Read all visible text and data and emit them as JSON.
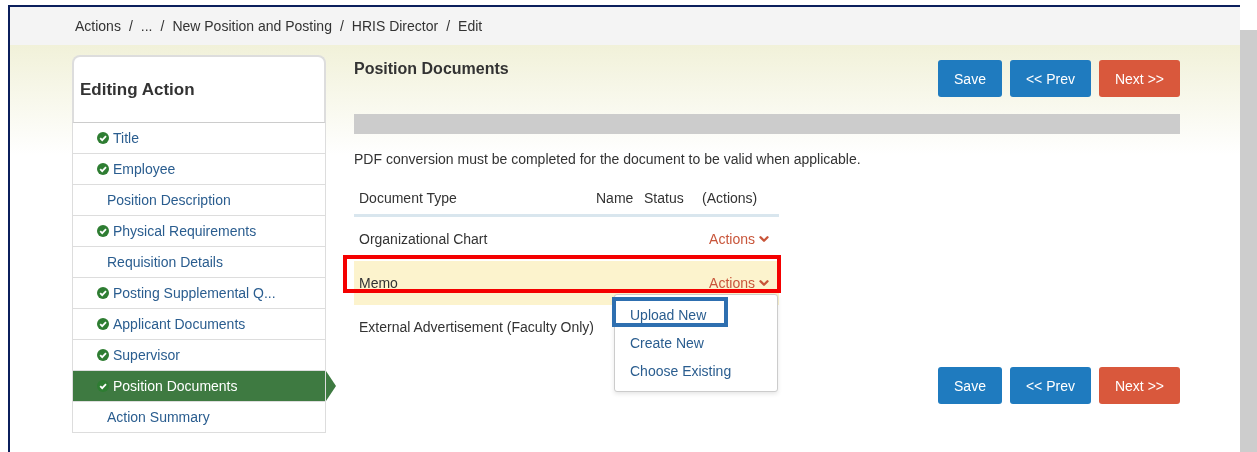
{
  "breadcrumb": {
    "separator": "/",
    "items": [
      "Actions",
      "...",
      "New Position and Posting",
      "HRIS Director",
      "Edit"
    ]
  },
  "sidebar": {
    "title": "Editing Action",
    "items": [
      {
        "label": "Title",
        "complete": true,
        "selected": false
      },
      {
        "label": "Employee",
        "complete": true,
        "selected": false
      },
      {
        "label": "Position Description",
        "complete": false,
        "selected": false
      },
      {
        "label": "Physical Requirements",
        "complete": true,
        "selected": false
      },
      {
        "label": "Requisition Details",
        "complete": false,
        "selected": false
      },
      {
        "label": "Posting Supplemental Q...",
        "complete": true,
        "selected": false
      },
      {
        "label": "Applicant Documents",
        "complete": true,
        "selected": false
      },
      {
        "label": "Supervisor",
        "complete": true,
        "selected": false
      },
      {
        "label": "Position Documents",
        "complete": true,
        "selected": true
      },
      {
        "label": "Action Summary",
        "complete": false,
        "selected": false
      }
    ]
  },
  "main": {
    "title": "Position Documents",
    "buttons": [
      {
        "label": "Save",
        "kind": "primary"
      },
      {
        "label": "<< Prev",
        "kind": "primary"
      },
      {
        "label": "Next >>",
        "kind": "danger"
      }
    ],
    "notice": "PDF conversion must be completed for the document to be valid when applicable.",
    "table": {
      "columns": [
        "Document Type",
        "Name",
        "Status",
        "(Actions)"
      ],
      "rows": [
        {
          "document_type": "Organizational Chart",
          "action": "Actions",
          "highlighted": false,
          "outlined": false,
          "menu_open": false
        },
        {
          "document_type": "Memo",
          "action": "Actions",
          "highlighted": true,
          "outlined": true,
          "menu_open": true
        },
        {
          "document_type": "External Advertisement (Faculty Only)",
          "action": null,
          "highlighted": false,
          "outlined": false
        }
      ]
    },
    "menu": [
      {
        "label": "Upload New",
        "outlined": true
      },
      {
        "label": "Create New",
        "outlined": false
      },
      {
        "label": "Choose Existing",
        "outlined": false
      }
    ],
    "bottom_buttons": [
      {
        "label": "Save",
        "kind": "primary"
      },
      {
        "label": "<< Prev",
        "kind": "primary"
      },
      {
        "label": "Next >>",
        "kind": "danger"
      }
    ]
  }
}
